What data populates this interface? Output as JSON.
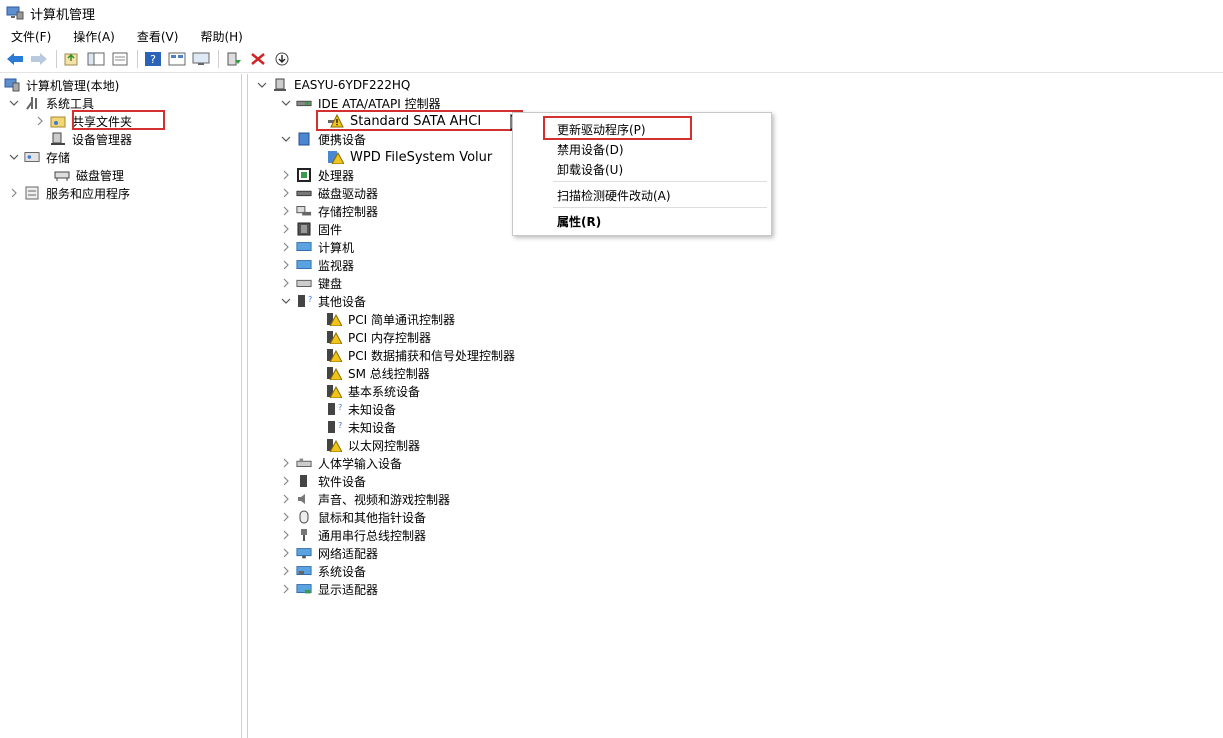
{
  "window": {
    "title": "计算机管理"
  },
  "menu": [
    "文件(F)",
    "操作(A)",
    "查看(V)",
    "帮助(H)"
  ],
  "toolbar_icons": [
    "back-arrow-icon",
    "forward-arrow-icon",
    "up-folder-icon",
    "show-hide-tree-icon",
    "properties-icon",
    "help-icon",
    "view-icon",
    "console-icon",
    "update-driver-icon",
    "uninstall-icon",
    "scan-hardware-icon"
  ],
  "left_tree": {
    "root": "计算机管理(本地)",
    "system_tools": "系统工具",
    "shared_folders": "共享文件夹",
    "device_manager": "设备管理器",
    "storage": "存储",
    "disk_management": "磁盘管理",
    "services_apps": "服务和应用程序"
  },
  "right_tree": {
    "computer": "EASYU-6YDF222HQ",
    "ide": "IDE ATA/ATAPI 控制器",
    "sata": "Standard SATA AHCI",
    "portable": "便携设备",
    "wpd": "WPD FileSystem Volur",
    "processor": "处理器",
    "disk_drives": "磁盘驱动器",
    "storage_ctrl": "存储控制器",
    "firmware": "固件",
    "computer_cat": "计算机",
    "monitor": "监视器",
    "keyboard": "键盘",
    "other_devices": "其他设备",
    "pci_comm": "PCI 简单通讯控制器",
    "pci_mem": "PCI 内存控制器",
    "pci_data": "PCI 数据捕获和信号处理控制器",
    "sm_bus": "SM 总线控制器",
    "base_sys": "基本系统设备",
    "unknown1": "未知设备",
    "unknown2": "未知设备",
    "ethernet": "以太网控制器",
    "hid": "人体学输入设备",
    "software_dev": "软件设备",
    "audio": "声音、视频和游戏控制器",
    "mouse": "鼠标和其他指针设备",
    "usb": "通用串行总线控制器",
    "network": "网络适配器",
    "system_dev": "系统设备",
    "display": "显示适配器"
  },
  "context_menu": {
    "update_driver": "更新驱动程序(P)",
    "disable": "禁用设备(D)",
    "uninstall": "卸载设备(U)",
    "scan": "扫描检测硬件改动(A)",
    "properties": "属性(R)"
  },
  "colors": {
    "highlight_box": "#d3302f",
    "warning": "#f0c419"
  }
}
